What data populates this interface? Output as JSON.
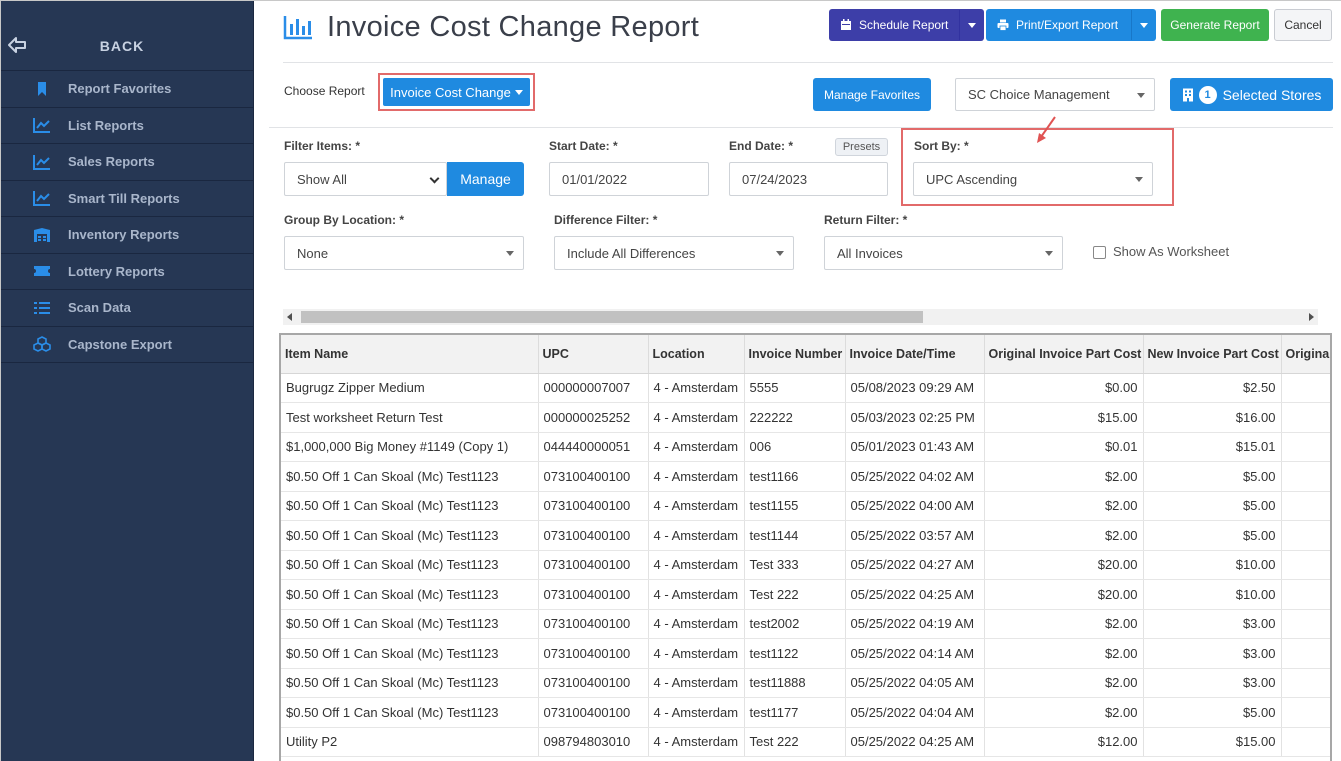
{
  "sidebar": {
    "back_label": "BACK",
    "items": [
      {
        "label": "Report Favorites",
        "icon": "bookmark-icon"
      },
      {
        "label": "List Reports",
        "icon": "line-chart-icon"
      },
      {
        "label": "Sales Reports",
        "icon": "line-chart-icon"
      },
      {
        "label": "Smart Till Reports",
        "icon": "line-chart-icon"
      },
      {
        "label": "Inventory Reports",
        "icon": "warehouse-icon"
      },
      {
        "label": "Lottery Reports",
        "icon": "ticket-icon"
      },
      {
        "label": "Scan Data",
        "icon": "list-icon"
      },
      {
        "label": "Capstone Export",
        "icon": "cubes-icon"
      }
    ]
  },
  "header": {
    "title": "Invoice Cost Change Report",
    "schedule_label": "Schedule Report",
    "print_label": "Print/Export Report",
    "generate_label": "Generate Report",
    "cancel_label": "Cancel"
  },
  "choose": {
    "label": "Choose Report",
    "value": "Invoice Cost Change",
    "manage_favorites": "Manage Favorites",
    "company": "SC Choice Management",
    "stores_count": "1",
    "stores_label": "Selected Stores"
  },
  "filters": {
    "filter_items_label": "Filter Items: *",
    "filter_items_value": "Show All",
    "manage_label": "Manage",
    "start_label": "Start Date: *",
    "start_value": "01/01/2022",
    "end_label": "End Date: *",
    "presets_label": "Presets",
    "end_value": "07/24/2023",
    "sort_label": "Sort By: *",
    "sort_value": "UPC Ascending",
    "group_label": "Group By Location: *",
    "group_value": "None",
    "diff_label": "Difference Filter: *",
    "diff_value": "Include All Differences",
    "return_label": "Return Filter: *",
    "return_value": "All Invoices",
    "worksheet_label": "Show As Worksheet"
  },
  "colors": {
    "sidebar_bg": "#263754",
    "primary": "#1f8ae0",
    "schedule": "#3d3ea8",
    "generate": "#3fb34f",
    "highlight": "#e26a6a"
  },
  "table": {
    "columns": [
      "Item Name",
      "UPC",
      "Location",
      "Invoice Number",
      "Invoice Date/Time",
      "Original Invoice Part Cost",
      "New Invoice Part Cost",
      "Original"
    ],
    "rows": [
      [
        "Bugrugz Zipper Medium",
        "000000007007",
        "4 - Amsterdam",
        "5555",
        "05/08/2023 09:29 AM",
        "$0.00",
        "$2.50",
        ""
      ],
      [
        "Test worksheet Return Test",
        "000000025252",
        "4 - Amsterdam",
        "222222",
        "05/03/2023 02:25 PM",
        "$15.00",
        "$16.00",
        ""
      ],
      [
        "$1,000,000 Big Money #1149 (Copy 1)",
        "044440000051",
        "4 - Amsterdam",
        "006",
        "05/01/2023 01:43 AM",
        "$0.01",
        "$15.01",
        ""
      ],
      [
        "$0.50 Off 1 Can Skoal (Mc) Test1123",
        "073100400100",
        "4 - Amsterdam",
        "test1166",
        "05/25/2022 04:02 AM",
        "$2.00",
        "$5.00",
        ""
      ],
      [
        "$0.50 Off 1 Can Skoal (Mc) Test1123",
        "073100400100",
        "4 - Amsterdam",
        "test1155",
        "05/25/2022 04:00 AM",
        "$2.00",
        "$5.00",
        ""
      ],
      [
        "$0.50 Off 1 Can Skoal (Mc) Test1123",
        "073100400100",
        "4 - Amsterdam",
        "test1144",
        "05/25/2022 03:57 AM",
        "$2.00",
        "$5.00",
        ""
      ],
      [
        "$0.50 Off 1 Can Skoal (Mc) Test1123",
        "073100400100",
        "4 - Amsterdam",
        "Test 333",
        "05/25/2022 04:27 AM",
        "$20.00",
        "$10.00",
        ""
      ],
      [
        "$0.50 Off 1 Can Skoal (Mc) Test1123",
        "073100400100",
        "4 - Amsterdam",
        "Test 222",
        "05/25/2022 04:25 AM",
        "$20.00",
        "$10.00",
        ""
      ],
      [
        "$0.50 Off 1 Can Skoal (Mc) Test1123",
        "073100400100",
        "4 - Amsterdam",
        "test2002",
        "05/25/2022 04:19 AM",
        "$2.00",
        "$3.00",
        ""
      ],
      [
        "$0.50 Off 1 Can Skoal (Mc) Test1123",
        "073100400100",
        "4 - Amsterdam",
        "test1122",
        "05/25/2022 04:14 AM",
        "$2.00",
        "$3.00",
        ""
      ],
      [
        "$0.50 Off 1 Can Skoal (Mc) Test1123",
        "073100400100",
        "4 - Amsterdam",
        "test11888",
        "05/25/2022 04:05 AM",
        "$2.00",
        "$3.00",
        ""
      ],
      [
        "$0.50 Off 1 Can Skoal (Mc) Test1123",
        "073100400100",
        "4 - Amsterdam",
        "test1177",
        "05/25/2022 04:04 AM",
        "$2.00",
        "$5.00",
        ""
      ],
      [
        "Utility P2",
        "098794803010",
        "4 - Amsterdam",
        "Test 222",
        "05/25/2022 04:25 AM",
        "$12.00",
        "$15.00",
        ""
      ]
    ]
  }
}
